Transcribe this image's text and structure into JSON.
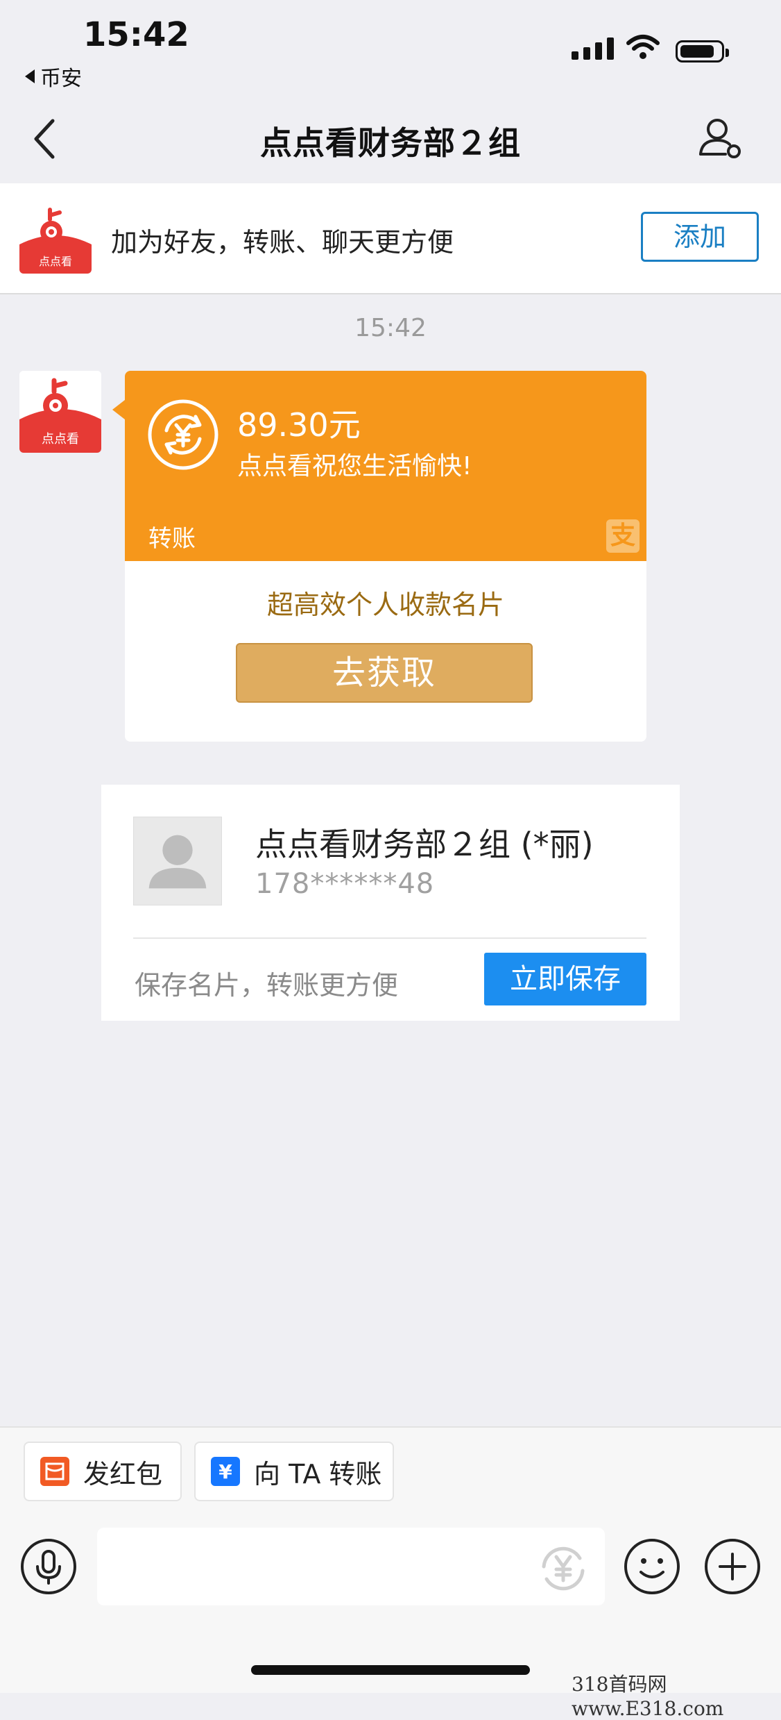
{
  "status_bar": {
    "time": "15:42",
    "back_app": "币安"
  },
  "nav": {
    "title": "点点看财务部２组"
  },
  "banner": {
    "text": "加为好友，转账、聊天更方便",
    "add_label": "添加"
  },
  "chat": {
    "timestamp": "15:42"
  },
  "transfer_card": {
    "amount": "89.30元",
    "wish": "点点看祝您生活愉快!",
    "type_label": "转账",
    "promo": "超高效个人收款名片",
    "get_label": "去获取"
  },
  "contact_card": {
    "name": "点点看财务部２组 (*丽)",
    "phone": "178******48",
    "hint": "保存名片，转账更方便",
    "save_label": "立即保存"
  },
  "toolbar": {
    "red_packet_label": "发红包",
    "transfer_label": "向 TA 转账"
  },
  "watermark": "318首码网 www.E318.com",
  "logo_text": "点点看",
  "colors": {
    "transfer_orange": "#f6971b",
    "accent_blue": "#1a7fc3",
    "save_blue": "#1c8ef0",
    "gold": "#dfac5f"
  }
}
